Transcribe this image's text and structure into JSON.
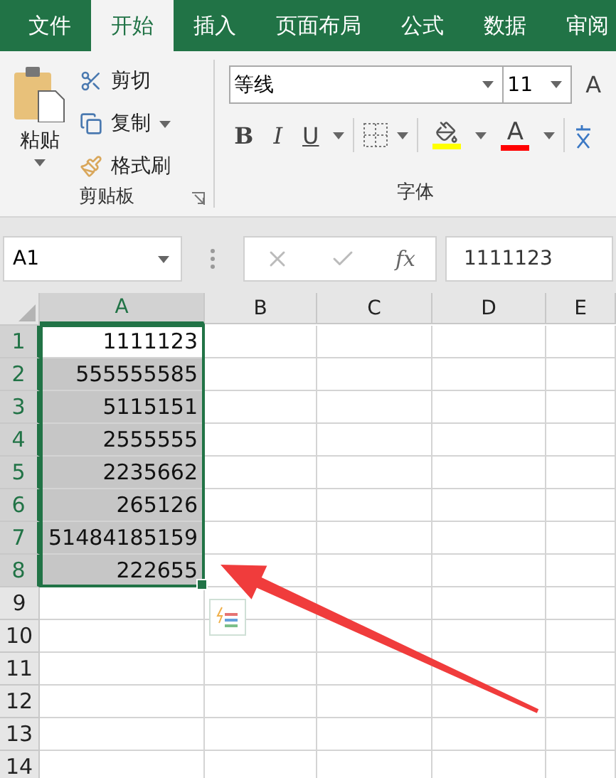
{
  "tabs": [
    {
      "label": "文件",
      "selected": false
    },
    {
      "label": "开始",
      "selected": true
    },
    {
      "label": "插入",
      "selected": false
    },
    {
      "label": "页面布局",
      "selected": false
    },
    {
      "label": "公式",
      "selected": false
    },
    {
      "label": "数据",
      "selected": false
    },
    {
      "label": "审阅",
      "selected": false
    }
  ],
  "clipboard": {
    "paste": "粘贴",
    "cut": "剪切",
    "copy": "复制",
    "format_painter": "格式刷",
    "group_label": "剪贴板"
  },
  "font": {
    "font_name": "等线",
    "font_size": "11",
    "grow": "A",
    "bold": "B",
    "italic": "I",
    "underline": "U",
    "font_color": "A",
    "group_label": "字体"
  },
  "formula_bar": {
    "name_box": "A1",
    "function_button": "fx",
    "value": "1111123"
  },
  "sheet": {
    "columns": [
      {
        "label": "A",
        "selected": true
      },
      {
        "label": "B",
        "selected": false
      },
      {
        "label": "C",
        "selected": false
      },
      {
        "label": "D",
        "selected": false
      },
      {
        "label": "E",
        "selected": false
      }
    ],
    "rows": [
      {
        "label": "1",
        "selected": true,
        "active": true,
        "value": "1111123"
      },
      {
        "label": "2",
        "selected": true,
        "active": false,
        "value": "555555585"
      },
      {
        "label": "3",
        "selected": true,
        "active": false,
        "value": "5115151"
      },
      {
        "label": "4",
        "selected": true,
        "active": false,
        "value": "2555555"
      },
      {
        "label": "5",
        "selected": true,
        "active": false,
        "value": "2235662"
      },
      {
        "label": "6",
        "selected": true,
        "active": false,
        "value": "265126"
      },
      {
        "label": "7",
        "selected": true,
        "active": false,
        "value": "51484185159"
      },
      {
        "label": "8",
        "selected": true,
        "active": false,
        "value": "222655"
      },
      {
        "label": "9",
        "selected": false,
        "active": false
      },
      {
        "label": "10",
        "selected": false,
        "active": false
      },
      {
        "label": "11",
        "selected": false,
        "active": false
      },
      {
        "label": "12",
        "selected": false,
        "active": false
      },
      {
        "label": "13",
        "selected": false,
        "active": false
      },
      {
        "label": "14",
        "selected": false,
        "active": false
      }
    ]
  }
}
